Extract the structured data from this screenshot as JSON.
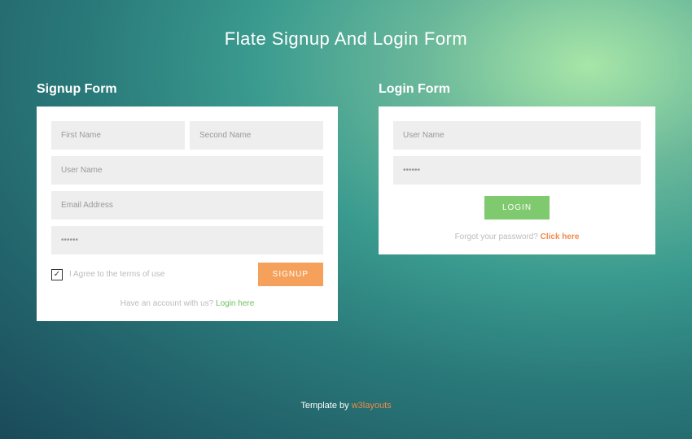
{
  "page": {
    "title": "Flate Signup And Login Form"
  },
  "signup": {
    "heading": "Signup Form",
    "first_name_placeholder": "First Name",
    "second_name_placeholder": "Second Name",
    "user_name_placeholder": "User Name",
    "email_placeholder": "Email Address",
    "password_placeholder": "••••••",
    "terms_text": "I Agree to the terms of use",
    "terms_checked": true,
    "submit_label": "SIGNUP",
    "bottom_prompt": "Have an account with us?  ",
    "bottom_link": "Login here"
  },
  "login": {
    "heading": "Login Form",
    "user_name_placeholder": "User Name",
    "password_placeholder": "••••••",
    "submit_label": "LOGIN",
    "bottom_prompt": "Forgot your password?  ",
    "bottom_link": "Click here"
  },
  "footer": {
    "prefix": "Template by ",
    "link": "w3layouts"
  },
  "colors": {
    "accent_orange": "#f5a15c",
    "accent_green": "#7fc96e",
    "link_green": "#6ebd5f",
    "link_orange": "#f08a4a"
  }
}
